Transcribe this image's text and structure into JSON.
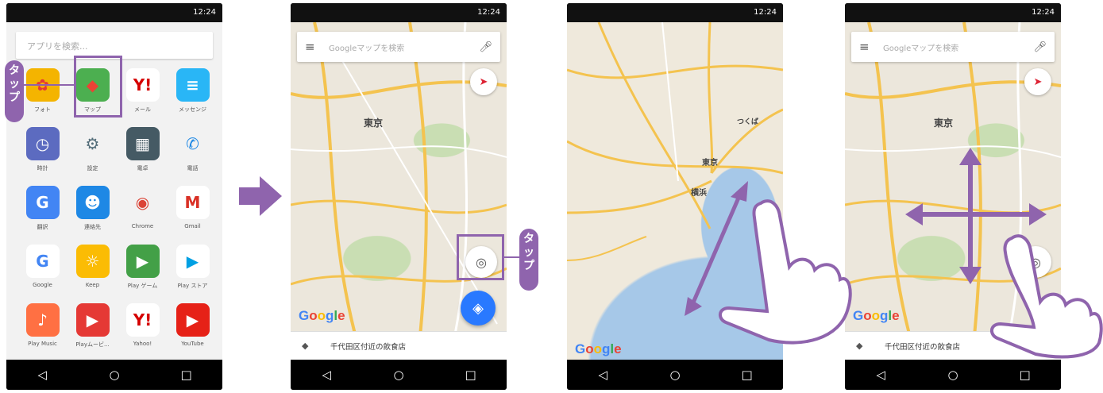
{
  "status": {
    "time": "12:24"
  },
  "drawer": {
    "search_placeholder": "アプリを検索...",
    "apps": [
      {
        "label": "フォト",
        "icon": "photos-pinwheel-icon",
        "glyph": "✿",
        "color": "#f4b400",
        "text": "#e53935"
      },
      {
        "label": "マップ",
        "icon": "maps-icon",
        "glyph": "◆",
        "color": "#4caf50",
        "text": "#ea4335"
      },
      {
        "label": "メール",
        "icon": "yahoo-mail-icon",
        "glyph": "Y!",
        "color": "#ffffff",
        "text": "#d50000"
      },
      {
        "label": "メッセンジ",
        "icon": "messenger-icon",
        "glyph": "≡",
        "color": "#29b6f6",
        "text": "#ffffff"
      },
      {
        "label": "時計",
        "icon": "clock-icon",
        "glyph": "◷",
        "color": "#5c6bc0",
        "text": "#ffffff"
      },
      {
        "label": "設定",
        "icon": "settings-gear-icon",
        "glyph": "⚙",
        "color": "#f2f2f2",
        "text": "#546e7a"
      },
      {
        "label": "電卓",
        "icon": "calculator-icon",
        "glyph": "▦",
        "color": "#455a64",
        "text": "#ffffff"
      },
      {
        "label": "電話",
        "icon": "phone-icon",
        "glyph": "✆",
        "color": "#f2f2f2",
        "text": "#1e88e5"
      },
      {
        "label": "翻訳",
        "icon": "translate-icon",
        "glyph": "G",
        "color": "#4285f4",
        "text": "#ffffff"
      },
      {
        "label": "連絡先",
        "icon": "contacts-icon",
        "glyph": "☻",
        "color": "#1e88e5",
        "text": "#ffffff"
      },
      {
        "label": "Chrome",
        "icon": "chrome-icon",
        "glyph": "◉",
        "color": "#f2f2f2",
        "text": "#db4437"
      },
      {
        "label": "Gmail",
        "icon": "gmail-icon",
        "glyph": "M",
        "color": "#ffffff",
        "text": "#d93025"
      },
      {
        "label": "Google",
        "icon": "google-icon",
        "glyph": "G",
        "color": "#ffffff",
        "text": "#4285f4"
      },
      {
        "label": "Keep",
        "icon": "keep-bulb-icon",
        "glyph": "☼",
        "color": "#fbbc04",
        "text": "#ffffff"
      },
      {
        "label": "Play ゲーム",
        "icon": "play-games-icon",
        "glyph": "▶",
        "color": "#43a047",
        "text": "#ffffff"
      },
      {
        "label": "Play ストア",
        "icon": "play-store-icon",
        "glyph": "▶",
        "color": "#ffffff",
        "text": "#00a0e3"
      },
      {
        "label": "Play Music",
        "icon": "play-music-icon",
        "glyph": "♪",
        "color": "#ff7043",
        "text": "#ffffff"
      },
      {
        "label": "Playムービ...",
        "icon": "play-movies-icon",
        "glyph": "▶",
        "color": "#e53935",
        "text": "#ffffff"
      },
      {
        "label": "Yahoo!",
        "icon": "yahoo-icon",
        "glyph": "Y!",
        "color": "#ffffff",
        "text": "#d50000"
      },
      {
        "label": "YouTube",
        "icon": "youtube-icon",
        "glyph": "▶",
        "color": "#e62117",
        "text": "#ffffff"
      }
    ]
  },
  "maps": {
    "search_placeholder": "Googleマップを検索",
    "bottom_card_text": "千代田区付近の飲食店",
    "logo_text": "Google",
    "city_label": "東京",
    "yokohama_label": "横浜",
    "tsukuba_label": "つくば"
  },
  "annotations": {
    "tap_label_1": "タップ",
    "tap_label_2": "タップ",
    "accent": "#8f64ad"
  }
}
